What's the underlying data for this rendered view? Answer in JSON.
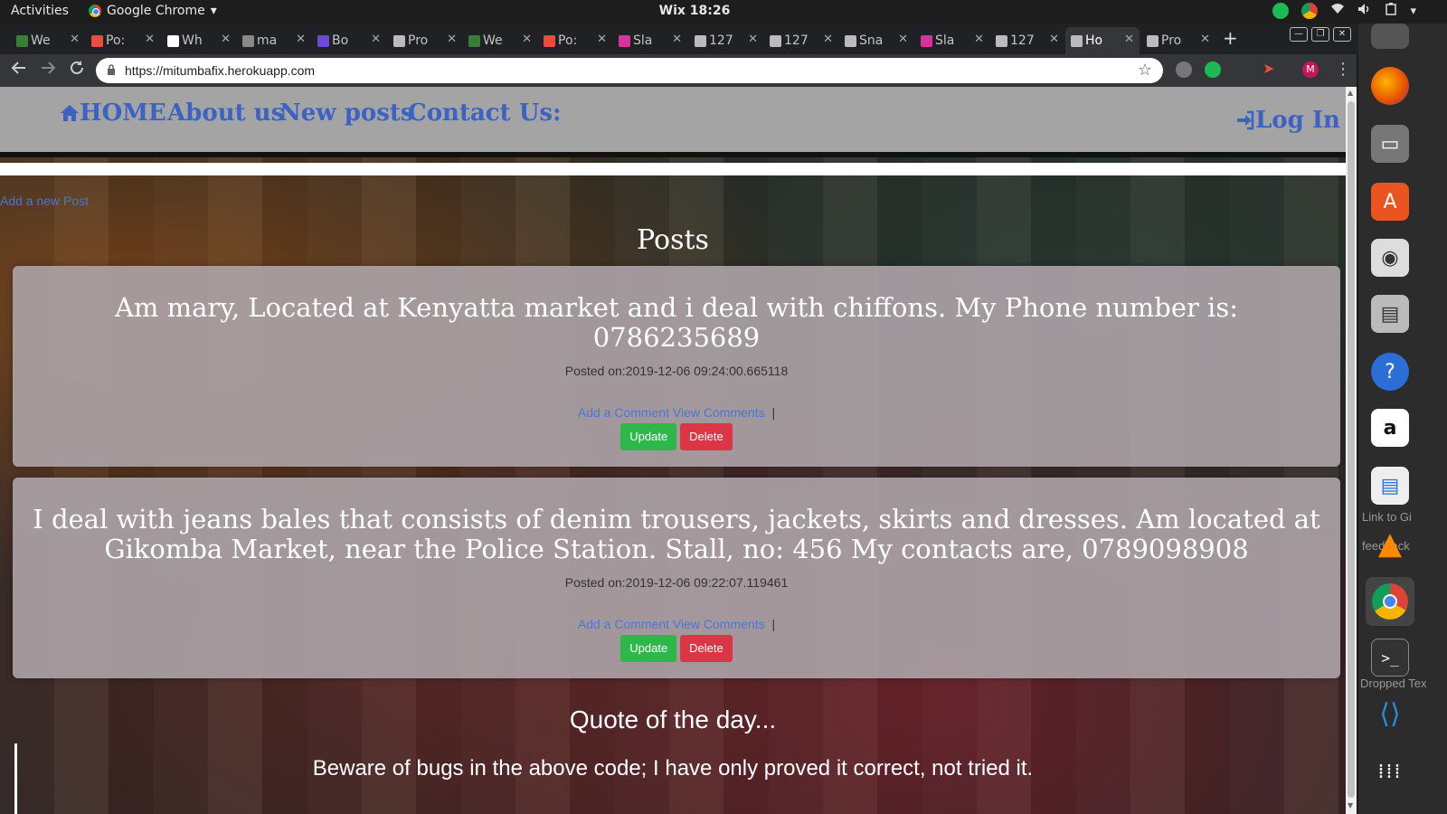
{
  "os_bar": {
    "activities": "Activities",
    "app_name": "Google Chrome",
    "app_menu_caret": "▾",
    "clock": "Wix 18:26"
  },
  "tabs": [
    {
      "label": "We",
      "color": "#3a7d3a"
    },
    {
      "label": "Po:",
      "color": "#e84d3d"
    },
    {
      "label": "Wh",
      "color": "#ffffff"
    },
    {
      "label": "ma",
      "color": "#888888"
    },
    {
      "label": "Bo",
      "color": "#6c4ad6"
    },
    {
      "label": "Pro",
      "color": "#bbbbbb"
    },
    {
      "label": "We",
      "color": "#3a7d3a"
    },
    {
      "label": "Po:",
      "color": "#e84d3d"
    },
    {
      "label": "Sla",
      "color": "#d6339b"
    },
    {
      "label": "127",
      "color": "#bbbbbb"
    },
    {
      "label": "127",
      "color": "#bbbbbb"
    },
    {
      "label": "Sna",
      "color": "#bbbbbb"
    },
    {
      "label": "Sla",
      "color": "#d6339b"
    },
    {
      "label": "127",
      "color": "#bbbbbb"
    },
    {
      "label": "Ho",
      "color": "#bbbbbb",
      "active": true
    },
    {
      "label": "Pro",
      "color": "#bbbbbb"
    }
  ],
  "browser": {
    "url": "https://mitumbafix.herokuapp.com",
    "new_tab": "+"
  },
  "site": {
    "nav": {
      "home": "HOME",
      "about": "About us",
      "new_posts": "New posts",
      "contact": "Contact Us:",
      "login": "Log In"
    },
    "add_post": "Add a new Post",
    "posts_title": "Posts",
    "posts": [
      {
        "content": "Am mary, Located at Kenyatta market and i deal with chiffons. My Phone number is: 0786235689",
        "date": "Posted on:2019-12-06 09:24:00.665118",
        "add_comment": "Add a Comment",
        "view_comments": "View Comments",
        "separator": "|",
        "update": "Update",
        "delete": "Delete"
      },
      {
        "content": "I deal with jeans bales that consists of denim trousers, jackets, skirts and dresses. Am located at Gikomba Market, near the Police Station. Stall, no: 456 My contacts are, 0789098908",
        "date": "Posted on:2019-12-06 09:22:07.119461",
        "add_comment": "Add a Comment",
        "view_comments": "View Comments",
        "separator": "|",
        "update": "Update",
        "delete": "Delete"
      }
    ],
    "quote_title": "Quote of the day...",
    "quote_text": "Beware of bugs in the above code; I have only proved it correct, not tried it."
  },
  "dock": {
    "items": [
      "files-icon",
      "firefox-icon",
      "file-manager-icon",
      "software-center-icon",
      "rhythmbox-icon",
      "printer-icon",
      "help-icon",
      "amazon-icon",
      "libreoffice-writer-icon",
      "vlc-icon",
      "chrome-icon",
      "terminal-icon",
      "vscode-icon",
      "app-grid-icon"
    ],
    "labels": {
      "link": "Link to Gi",
      "feedback": "feedback",
      "dropped": "Dropped Tex"
    }
  },
  "colors": {
    "nav_link": "#3c62c2",
    "update_button": "#2fb84a",
    "delete_button": "#dc3545",
    "link": "#4a76d6"
  }
}
